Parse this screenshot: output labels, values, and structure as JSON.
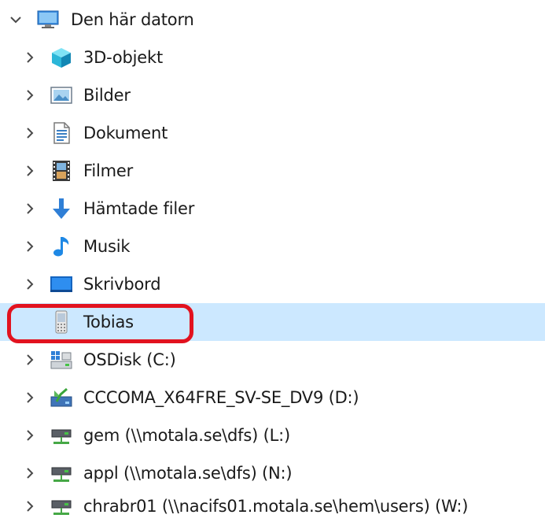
{
  "tree": {
    "root": {
      "label": "Den här datorn",
      "icon": "this-pc-icon",
      "expanded": true
    },
    "items": [
      {
        "label": "3D-objekt",
        "icon": "3d-objects-icon",
        "has_chevron": true
      },
      {
        "label": "Bilder",
        "icon": "pictures-icon",
        "has_chevron": true
      },
      {
        "label": "Dokument",
        "icon": "documents-icon",
        "has_chevron": true
      },
      {
        "label": "Filmer",
        "icon": "videos-icon",
        "has_chevron": true
      },
      {
        "label": "Hämtade filer",
        "icon": "downloads-icon",
        "has_chevron": true
      },
      {
        "label": "Musik",
        "icon": "music-icon",
        "has_chevron": true
      },
      {
        "label": "Skrivbord",
        "icon": "desktop-icon",
        "has_chevron": true
      },
      {
        "label": "Tobias",
        "icon": "phone-device-icon",
        "has_chevron": false,
        "selected": true,
        "circled": true
      },
      {
        "label": "OSDisk (C:)",
        "icon": "os-drive-icon",
        "has_chevron": true
      },
      {
        "label": "CCCOMA_X64FRE_SV-SE_DV9 (D:)",
        "icon": "dvd-drive-icon",
        "has_chevron": true
      },
      {
        "label": "gem (\\\\motala.se\\dfs) (L:)",
        "icon": "network-drive-icon",
        "has_chevron": true
      },
      {
        "label": "appl (\\\\motala.se\\dfs) (N:)",
        "icon": "network-drive-icon",
        "has_chevron": true
      },
      {
        "label": "chrabr01 (\\\\nacifs01.motala.se\\hem\\users) (W:)",
        "icon": "network-drive-icon",
        "has_chevron": true
      }
    ]
  },
  "colors": {
    "selection": "#cce8ff",
    "annotation_ring": "#e2121f",
    "chevron": "#4a4a4a"
  }
}
